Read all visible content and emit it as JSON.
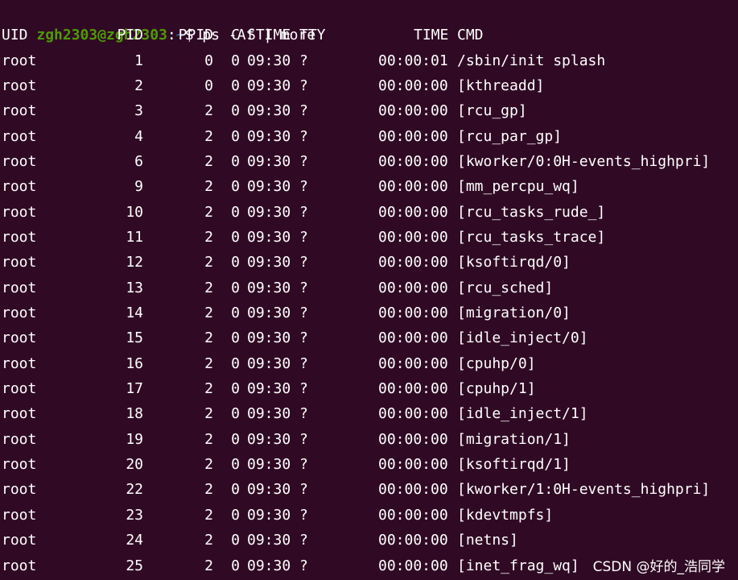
{
  "prompt": {
    "user_host": "zgh2303@zgh2303",
    "separator": ":",
    "path": "~",
    "dollar": "$",
    "command": " ps -Af | more"
  },
  "table": {
    "headers": [
      "UID",
      "PID",
      "PPID",
      "C",
      "STIME",
      "TTY",
      "TIME",
      "CMD"
    ],
    "rows": [
      [
        "root",
        "1",
        "0",
        "0",
        "09:30",
        "?",
        "00:00:01",
        "/sbin/init splash"
      ],
      [
        "root",
        "2",
        "0",
        "0",
        "09:30",
        "?",
        "00:00:00",
        "[kthreadd]"
      ],
      [
        "root",
        "3",
        "2",
        "0",
        "09:30",
        "?",
        "00:00:00",
        "[rcu_gp]"
      ],
      [
        "root",
        "4",
        "2",
        "0",
        "09:30",
        "?",
        "00:00:00",
        "[rcu_par_gp]"
      ],
      [
        "root",
        "6",
        "2",
        "0",
        "09:30",
        "?",
        "00:00:00",
        "[kworker/0:0H-events_highpri]"
      ],
      [
        "root",
        "9",
        "2",
        "0",
        "09:30",
        "?",
        "00:00:00",
        "[mm_percpu_wq]"
      ],
      [
        "root",
        "10",
        "2",
        "0",
        "09:30",
        "?",
        "00:00:00",
        "[rcu_tasks_rude_]"
      ],
      [
        "root",
        "11",
        "2",
        "0",
        "09:30",
        "?",
        "00:00:00",
        "[rcu_tasks_trace]"
      ],
      [
        "root",
        "12",
        "2",
        "0",
        "09:30",
        "?",
        "00:00:00",
        "[ksoftirqd/0]"
      ],
      [
        "root",
        "13",
        "2",
        "0",
        "09:30",
        "?",
        "00:00:00",
        "[rcu_sched]"
      ],
      [
        "root",
        "14",
        "2",
        "0",
        "09:30",
        "?",
        "00:00:00",
        "[migration/0]"
      ],
      [
        "root",
        "15",
        "2",
        "0",
        "09:30",
        "?",
        "00:00:00",
        "[idle_inject/0]"
      ],
      [
        "root",
        "16",
        "2",
        "0",
        "09:30",
        "?",
        "00:00:00",
        "[cpuhp/0]"
      ],
      [
        "root",
        "17",
        "2",
        "0",
        "09:30",
        "?",
        "00:00:00",
        "[cpuhp/1]"
      ],
      [
        "root",
        "18",
        "2",
        "0",
        "09:30",
        "?",
        "00:00:00",
        "[idle_inject/1]"
      ],
      [
        "root",
        "19",
        "2",
        "0",
        "09:30",
        "?",
        "00:00:00",
        "[migration/1]"
      ],
      [
        "root",
        "20",
        "2",
        "0",
        "09:30",
        "?",
        "00:00:00",
        "[ksoftirqd/1]"
      ],
      [
        "root",
        "22",
        "2",
        "0",
        "09:30",
        "?",
        "00:00:00",
        "[kworker/1:0H-events_highpri]"
      ],
      [
        "root",
        "23",
        "2",
        "0",
        "09:30",
        "?",
        "00:00:00",
        "[kdevtmpfs]"
      ],
      [
        "root",
        "24",
        "2",
        "0",
        "09:30",
        "?",
        "00:00:00",
        "[netns]"
      ],
      [
        "root",
        "25",
        "2",
        "0",
        "09:30",
        "?",
        "00:00:00",
        "[inet_frag_wq]"
      ]
    ]
  },
  "watermark": "CSDN @好的_浩同学",
  "colors": {
    "background": "#300a24",
    "prompt_user": "#4e9a06",
    "prompt_path": "#3465a4",
    "text": "#ffffff"
  }
}
